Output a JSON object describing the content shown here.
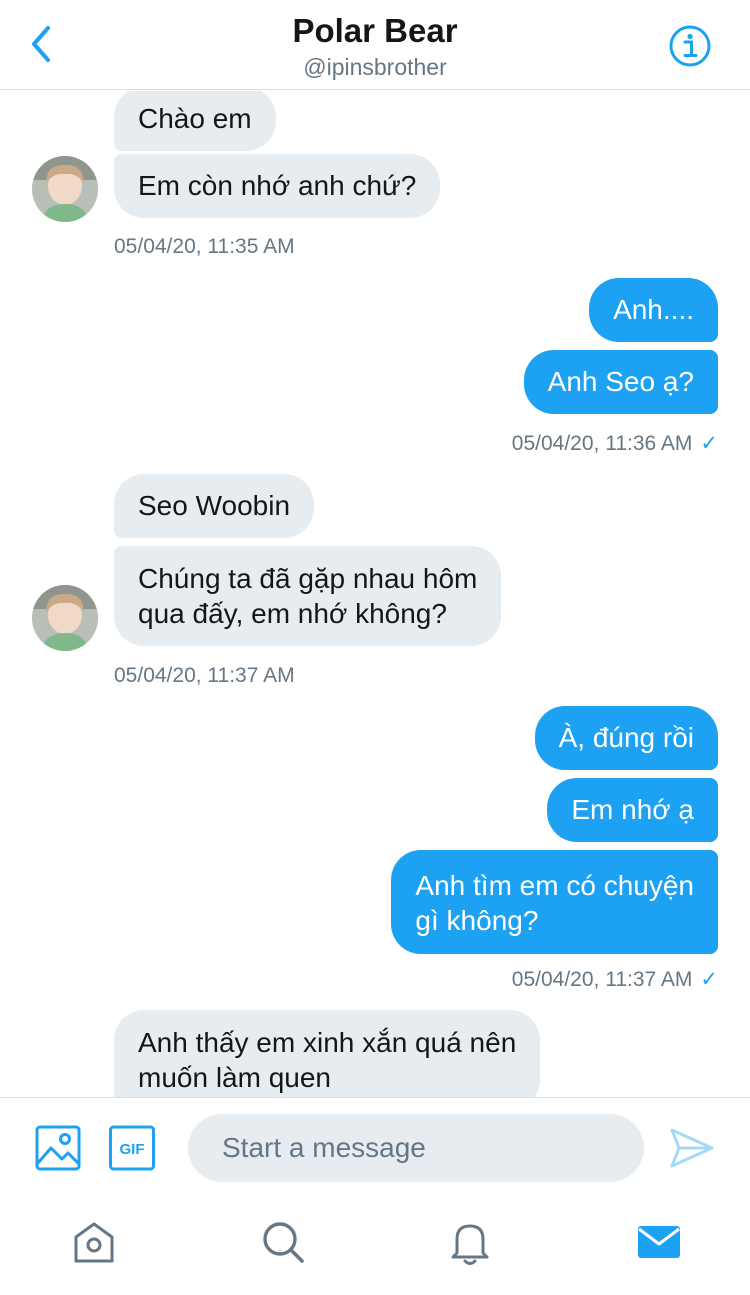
{
  "header": {
    "title": "Polar Bear",
    "handle": "@ipinsbrother",
    "back_icon": "chevron-left-icon",
    "info_icon": "info-icon"
  },
  "messages": [
    {
      "side": "in",
      "text": "Chào em"
    },
    {
      "side": "in",
      "text": "Em còn nhớ anh chứ?"
    },
    {
      "side": "in",
      "timestamp": "05/04/20, 11:35 AM"
    },
    {
      "side": "out",
      "text": "Anh...."
    },
    {
      "side": "out",
      "text": "Anh Seo ạ?"
    },
    {
      "side": "out",
      "timestamp": "05/04/20, 11:36 AM",
      "status": "✓"
    },
    {
      "side": "in",
      "text": "Seo Woobin"
    },
    {
      "side": "in",
      "text": "Chúng ta đã gặp nhau hôm",
      "text2": "qua đấy, em nhớ không?"
    },
    {
      "side": "in",
      "timestamp": "05/04/20, 11:37 AM"
    },
    {
      "side": "out",
      "text": "À, đúng rồi"
    },
    {
      "side": "out",
      "text": "Em nhớ ạ"
    },
    {
      "side": "out",
      "text": "Anh tìm em có chuyện",
      "text2": "gì không?"
    },
    {
      "side": "out",
      "timestamp": "05/04/20, 11:37 AM",
      "status": "✓"
    },
    {
      "side": "in",
      "text": "Anh thấy em xinh xắn quá nên",
      "text2": "muốn làm quen"
    }
  ],
  "composer": {
    "placeholder": "Start a message",
    "gif_label": "GIF",
    "image_icon": "image-icon",
    "send_icon": "send-icon"
  },
  "tabbar": {
    "items": [
      "home-icon",
      "search-icon",
      "notifications-bell-icon",
      "messages-envelope-icon"
    ],
    "active": "messages-envelope-icon"
  },
  "colors": {
    "accent": "#1da1f2",
    "incoming_bubble": "#e6ecf0",
    "secondary_text": "#657786",
    "divider": "#d8dee4"
  }
}
